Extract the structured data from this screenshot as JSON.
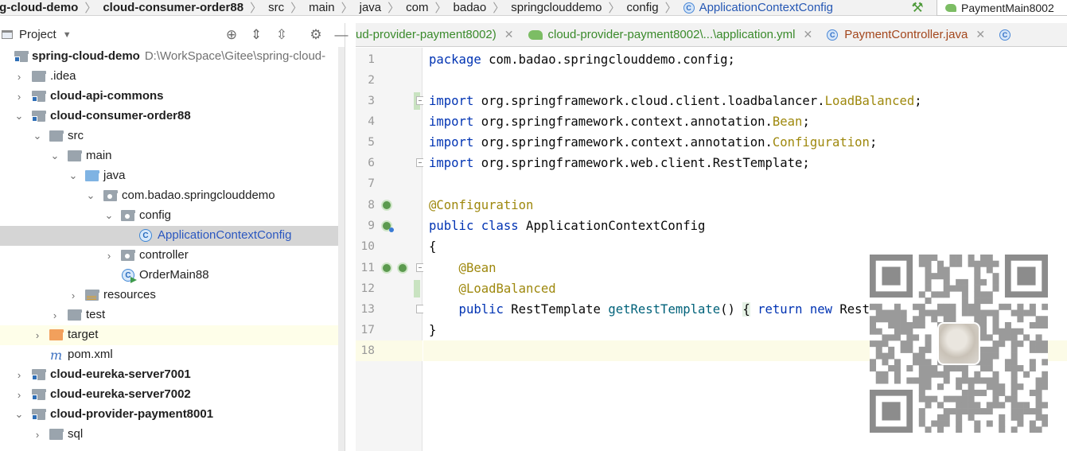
{
  "breadcrumb": {
    "items": [
      "ng-cloud-demo",
      "cloud-consumer-order88",
      "src",
      "main",
      "java",
      "com",
      "badao",
      "springclouddemo",
      "config",
      "ApplicationContextConfig"
    ]
  },
  "run_config": {
    "label": "PaymentMain8002"
  },
  "project_panel": {
    "title": "Project",
    "tree": [
      {
        "label": "spring-cloud-demo",
        "path": "D:\\WorkSpace\\Gitee\\spring-cloud-",
        "kind": "module",
        "expanded": true,
        "bold": true
      },
      {
        "label": ".idea",
        "kind": "folder",
        "expanded": false
      },
      {
        "label": "cloud-api-commons",
        "kind": "module",
        "expanded": false,
        "bold": true
      },
      {
        "label": "cloud-consumer-order88",
        "kind": "module",
        "expanded": true,
        "bold": true
      },
      {
        "label": "src",
        "kind": "folder",
        "expanded": true
      },
      {
        "label": "main",
        "kind": "folder",
        "expanded": true
      },
      {
        "label": "java",
        "kind": "source-folder",
        "expanded": true
      },
      {
        "label": "com.badao.springclouddemo",
        "kind": "package",
        "expanded": true
      },
      {
        "label": "config",
        "kind": "package",
        "expanded": true
      },
      {
        "label": "ApplicationContextConfig",
        "kind": "class",
        "selected": true
      },
      {
        "label": "controller",
        "kind": "package",
        "expanded": false
      },
      {
        "label": "OrderMain88",
        "kind": "class-runnable"
      },
      {
        "label": "resources",
        "kind": "resources-folder",
        "expanded": false
      },
      {
        "label": "test",
        "kind": "folder",
        "expanded": false
      },
      {
        "label": "target",
        "kind": "excluded-folder",
        "expanded": false
      },
      {
        "label": "pom.xml",
        "kind": "maven"
      },
      {
        "label": "cloud-eureka-server7001",
        "kind": "module",
        "expanded": false,
        "bold": true
      },
      {
        "label": "cloud-eureka-server7002",
        "kind": "module",
        "expanded": false,
        "bold": true
      },
      {
        "label": "cloud-provider-payment8001",
        "kind": "module",
        "expanded": true,
        "bold": true
      },
      {
        "label": "sql",
        "kind": "folder",
        "expanded": false
      }
    ]
  },
  "editor_tabs": [
    {
      "label": "ud-provider-payment8002)",
      "color": "green",
      "closable": true
    },
    {
      "label": "cloud-provider-payment8002\\...\\application.yml",
      "color": "green",
      "closable": true
    },
    {
      "label": "PaymentController.java",
      "color": "brown",
      "closable": true
    }
  ],
  "code": {
    "line_numbers": [
      "1",
      "2",
      "3",
      "4",
      "5",
      "6",
      "7",
      "8",
      "9",
      "10",
      "11",
      "12",
      "13",
      "17",
      "18"
    ],
    "lines": [
      "package com.badao.springclouddemo.config;",
      "",
      "import org.springframework.cloud.client.loadbalancer.LoadBalanced;",
      "import org.springframework.context.annotation.Bean;",
      "import org.springframework.context.annotation.Configuration;",
      "import org.springframework.web.client.RestTemplate;",
      "",
      "@Configuration",
      "public class ApplicationContextConfig",
      "{",
      "    @Bean",
      "    @LoadBalanced",
      "    public RestTemplate getRestTemplate() { return new RestTemplate(); }",
      "}",
      ""
    ],
    "current_line_index": 14
  },
  "colors": {
    "keyword": "#0033b3",
    "annotation": "#9e880d",
    "method": "#00627a",
    "selected_tree_text": "#2a57c0"
  }
}
